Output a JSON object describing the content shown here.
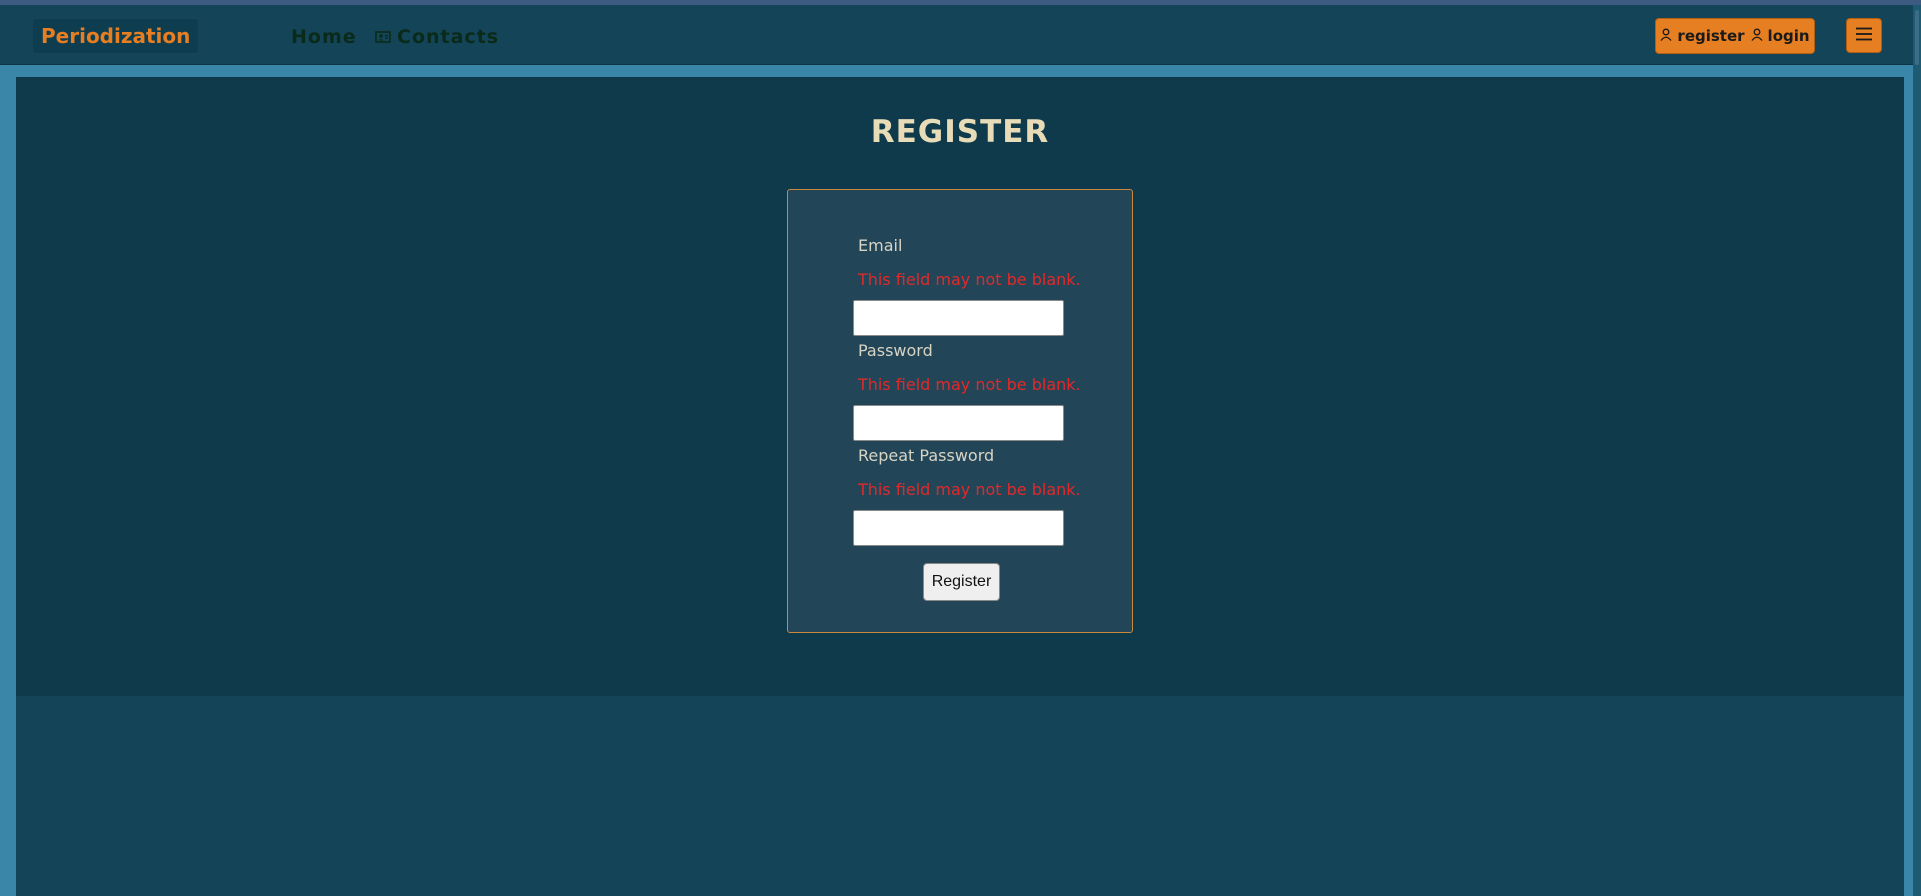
{
  "navbar": {
    "brand": "Periodization",
    "links": [
      {
        "label": "Home"
      },
      {
        "label": "Contacts"
      }
    ],
    "auth": {
      "register_label": "register",
      "login_label": "login"
    }
  },
  "main": {
    "title": "REGISTER",
    "form": {
      "email": {
        "label": "Email",
        "error": "This field may not be blank.",
        "value": ""
      },
      "password": {
        "label": "Password",
        "error": "This field may not be blank.",
        "value": ""
      },
      "repeat_password": {
        "label": "Repeat Password",
        "error": "This field may not be blank.",
        "value": ""
      },
      "submit_label": "Register"
    }
  },
  "icons": {
    "contacts": "contact-card-icon",
    "register": "user-icon",
    "login": "user-icon",
    "menu": "hamburger-menu-icon"
  },
  "colors": {
    "accent": "#e67e22",
    "navbar_bg": "#134458",
    "content_bg": "#0f3a4c",
    "form_bg": "#224558",
    "form_border": "#c98a3e",
    "error_text": "#e02a2a",
    "title_text": "#e8dcb8"
  }
}
